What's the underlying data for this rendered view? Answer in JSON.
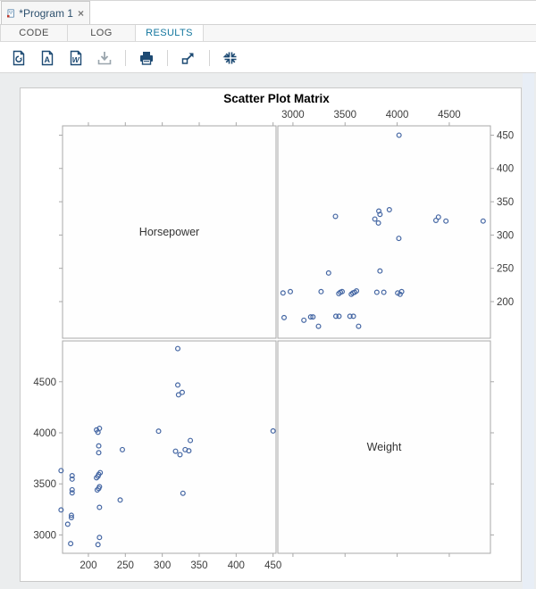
{
  "window": {
    "tab_title": "*Program 1",
    "close_label": "×"
  },
  "subtabs": [
    {
      "label": "CODE",
      "active": false
    },
    {
      "label": "LOG",
      "active": false
    },
    {
      "label": "RESULTS",
      "active": true
    }
  ],
  "toolbar": {
    "icons": [
      {
        "name": "results-html-icon"
      },
      {
        "name": "results-pdf-icon",
        "glyph": "A"
      },
      {
        "name": "results-word-icon",
        "glyph": "W"
      },
      {
        "name": "download-icon"
      },
      {
        "name": "print-icon"
      },
      {
        "name": "open-new-tab-icon"
      },
      {
        "name": "maximize-view-icon"
      }
    ]
  },
  "colors": {
    "accent_tab": "#13769e",
    "icon_navy": "#1d4a73",
    "icon_disabled": "#9aa5ad",
    "marker": "#4466a3",
    "panel_border": "#a8a8a8",
    "tick_label": "#3c3c3c",
    "title_color": "#000000"
  },
  "chart_data": {
    "type": "scatter",
    "subtype": "scatter-plot-matrix",
    "title": "Scatter Plot Matrix",
    "variables": [
      "Horsepower",
      "Weight"
    ],
    "diagonal_labels": [
      "Horsepower",
      "Weight"
    ],
    "legend": "none",
    "grid": false,
    "axes": {
      "horsepower": {
        "ticks": [
          200,
          250,
          300,
          350,
          400,
          450
        ],
        "range_x": [
          165,
          454
        ],
        "range_y": [
          145,
          464
        ]
      },
      "weight": {
        "ticks": [
          3000,
          3500,
          4000,
          4500
        ],
        "range_x": [
          2855,
          4895
        ],
        "range_y": [
          2820,
          4900
        ]
      }
    },
    "points": [
      {
        "horsepower": 213,
        "weight": 2905
      },
      {
        "horsepower": 215,
        "weight": 2975
      },
      {
        "horsepower": 215,
        "weight": 3270
      },
      {
        "horsepower": 212,
        "weight": 3440
      },
      {
        "horsepower": 214,
        "weight": 3455
      },
      {
        "horsepower": 215,
        "weight": 3472
      },
      {
        "horsepower": 211,
        "weight": 3560
      },
      {
        "horsepower": 213,
        "weight": 3575
      },
      {
        "horsepower": 214,
        "weight": 3592
      },
      {
        "horsepower": 216,
        "weight": 3610
      },
      {
        "horsepower": 214,
        "weight": 3805
      },
      {
        "horsepower": 214,
        "weight": 3872
      },
      {
        "horsepower": 213,
        "weight": 4005
      },
      {
        "horsepower": 211,
        "weight": 4028
      },
      {
        "horsepower": 215,
        "weight": 4043
      },
      {
        "horsepower": 176,
        "weight": 2915
      },
      {
        "horsepower": 177,
        "weight": 3170
      },
      {
        "horsepower": 177,
        "weight": 3192
      },
      {
        "horsepower": 178,
        "weight": 3412
      },
      {
        "horsepower": 178,
        "weight": 3442
      },
      {
        "horsepower": 178,
        "weight": 3547
      },
      {
        "horsepower": 178,
        "weight": 3580
      },
      {
        "horsepower": 163,
        "weight": 3245
      },
      {
        "horsepower": 172,
        "weight": 3105
      },
      {
        "horsepower": 163,
        "weight": 3630
      },
      {
        "horsepower": 243,
        "weight": 3342
      },
      {
        "horsepower": 246,
        "weight": 3835
      },
      {
        "horsepower": 295,
        "weight": 4016
      },
      {
        "horsepower": 324,
        "weight": 3786
      },
      {
        "horsepower": 331,
        "weight": 3835
      },
      {
        "horsepower": 318,
        "weight": 3820
      },
      {
        "horsepower": 336,
        "weight": 3824
      },
      {
        "horsepower": 338,
        "weight": 3925
      },
      {
        "horsepower": 328,
        "weight": 3408
      },
      {
        "horsepower": 322,
        "weight": 4372
      },
      {
        "horsepower": 327,
        "weight": 4396
      },
      {
        "horsepower": 321,
        "weight": 4468
      },
      {
        "horsepower": 321,
        "weight": 4825
      },
      {
        "horsepower": 450,
        "weight": 4018
      }
    ]
  }
}
